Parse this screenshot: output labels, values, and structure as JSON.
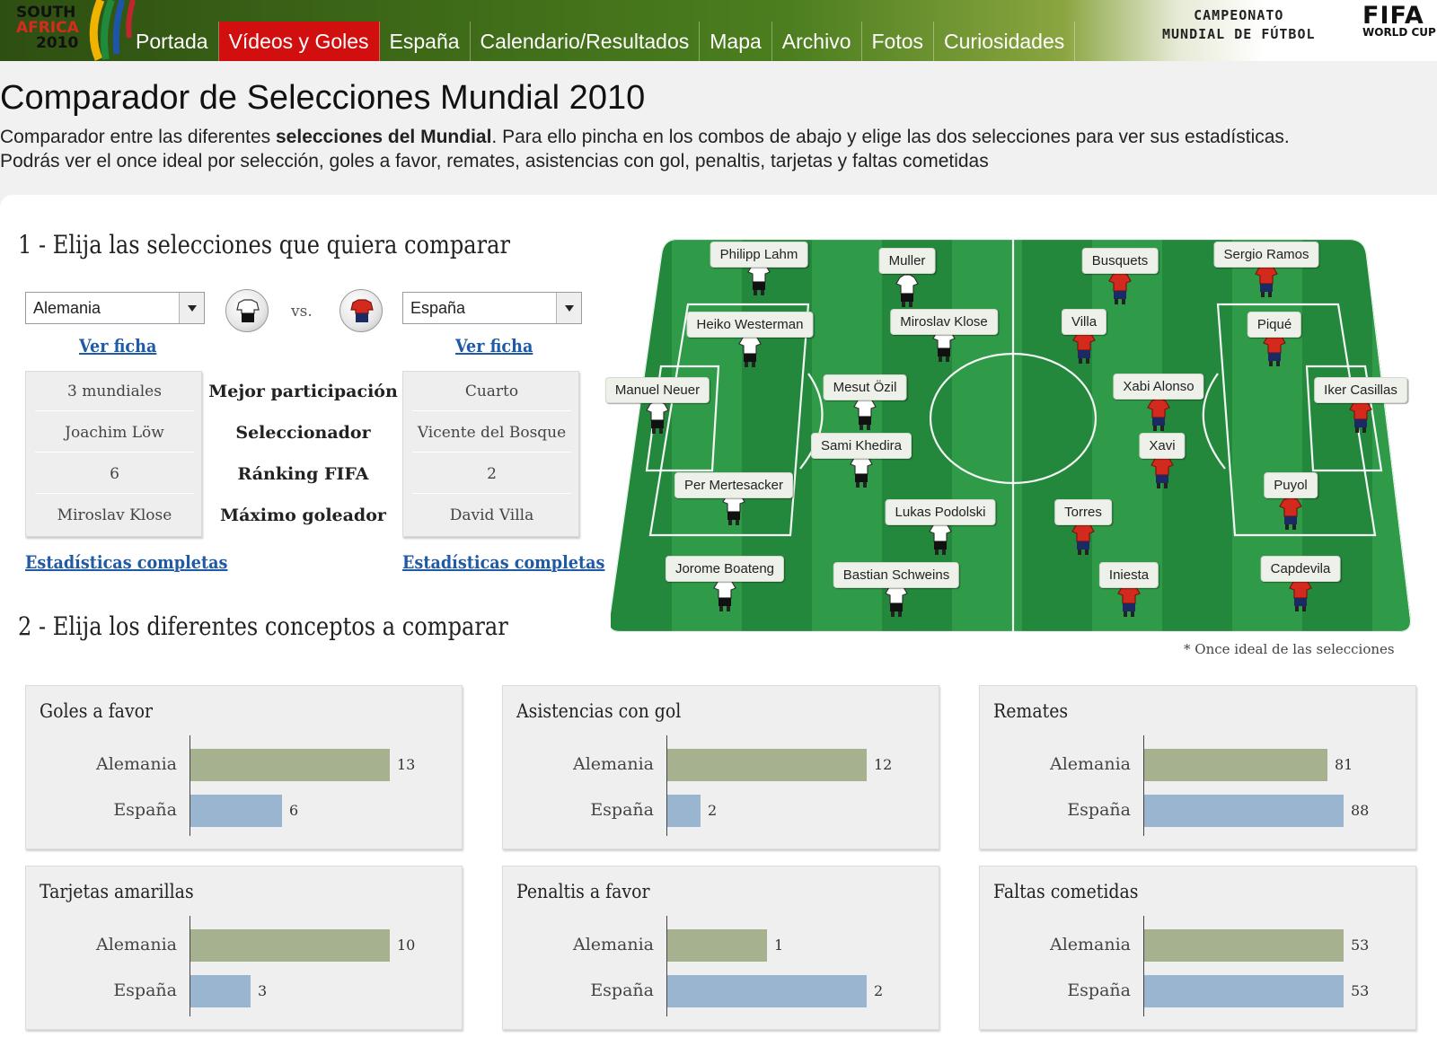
{
  "header": {
    "logo_line1": "SOUTH",
    "logo_line2": "AFRICA",
    "logo_line3": "2010",
    "nav": [
      {
        "label": "Portada",
        "active": false
      },
      {
        "label": "Vídeos y Goles",
        "active": true
      },
      {
        "label": "España",
        "active": false
      },
      {
        "label": "Calendario/Resultados",
        "active": false
      },
      {
        "label": "Mapa",
        "active": false
      },
      {
        "label": "Archivo",
        "active": false
      },
      {
        "label": "Fotos",
        "active": false
      },
      {
        "label": "Curiosidades",
        "active": false
      }
    ],
    "campeonato_line1": "CAMPEONATO",
    "campeonato_line2": "MUNDIAL DE FÚTBOL",
    "fifa_line1": "FIFA",
    "fifa_line2": "WORLD CUP"
  },
  "intro": {
    "title": "Comparador de Selecciones Mundial 2010",
    "line1_pre": "Comparador entre las diferentes ",
    "line1_bold": "selecciones del Mundial",
    "line1_post": ". Para ello pincha en los combos de abajo y elige las dos selecciones para ver sus estadísticas.",
    "line2": "Podrás ver el once ideal por selección, goles a favor, remates, asistencias con gol, penaltis, tarjetas y faltas cometidas"
  },
  "section1": {
    "title": "1 - Elija las selecciones que quiera comparar",
    "vs": "vs.",
    "team_a": {
      "selected": "Alemania",
      "ver_ficha": "Ver ficha",
      "stats_link": "Estadísticas completas",
      "values": [
        "3 mundiales",
        "Joachim Löw",
        "6",
        "Miroslav Klose"
      ]
    },
    "team_b": {
      "selected": "España",
      "ver_ficha": "Ver ficha",
      "stats_link": "Estadísticas completas",
      "values": [
        "Cuarto",
        "Vicente del Bosque",
        "2",
        "David Villa"
      ]
    },
    "labels": [
      "Mejor participación",
      "Seleccionador",
      "Ránking FIFA",
      "Máximo goleador"
    ]
  },
  "pitch": {
    "note": "* Once ideal de las selecciones",
    "colors": {
      "germany_shirt": "#ffffff",
      "germany_shorts": "#111111",
      "spain_shirt": "#d42a1e",
      "spain_shorts": "#1b2a63",
      "grass_dark": "#23873c",
      "grass_light": "#2f9a48"
    },
    "players": [
      "Philipp Lahm",
      "Muller",
      "Heiko Westerman",
      "Miroslav Klose",
      "Manuel Neuer",
      "Mesut Özil",
      "Sami Khedira",
      "Per Mertesacker",
      "Lukas Podolski",
      "Jorome Boateng",
      "Bastian Schweins",
      "Busquets",
      "Sergio Ramos",
      "Villa",
      "Piqué",
      "Xabi Alonso",
      "Iker Casillas",
      "Xavi",
      "Puyol",
      "Torres",
      "Iniesta",
      "Capdevila"
    ]
  },
  "section2": {
    "title": "2 - Elija los diferentes conceptos a comparar"
  },
  "chart_data": [
    {
      "type": "bar",
      "title": "Goles a favor",
      "categories": [
        "Alemania",
        "España"
      ],
      "values": [
        13,
        6
      ]
    },
    {
      "type": "bar",
      "title": "Asistencias con gol",
      "categories": [
        "Alemania",
        "España"
      ],
      "values": [
        12,
        2
      ]
    },
    {
      "type": "bar",
      "title": "Remates",
      "categories": [
        "Alemania",
        "España"
      ],
      "values": [
        81,
        88
      ]
    },
    {
      "type": "bar",
      "title": "Tarjetas amarillas",
      "categories": [
        "Alemania",
        "España"
      ],
      "values": [
        10,
        3
      ]
    },
    {
      "type": "bar",
      "title": "Penaltis a favor",
      "categories": [
        "Alemania",
        "España"
      ],
      "values": [
        1,
        2
      ]
    },
    {
      "type": "bar",
      "title": "Faltas cometidas",
      "categories": [
        "Alemania",
        "España"
      ],
      "values": [
        53,
        53
      ]
    }
  ],
  "bar_colors": {
    "alemania": "#a6b28f",
    "espana": "#9ab5cf"
  }
}
